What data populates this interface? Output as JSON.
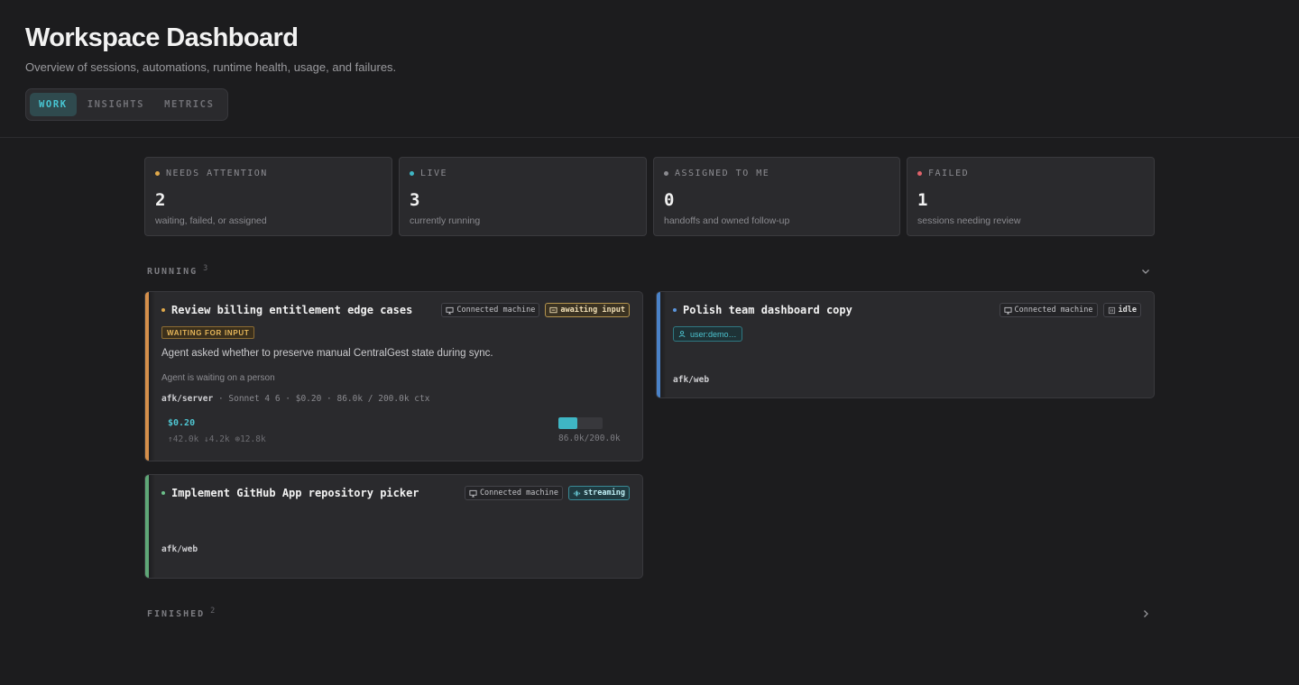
{
  "page": {
    "title": "Workspace Dashboard",
    "subtitle": "Overview of sessions, automations, runtime health, usage, and failures."
  },
  "tabs": [
    {
      "label": "WORK",
      "active": true
    },
    {
      "label": "INSIGHTS",
      "active": false
    },
    {
      "label": "METRICS",
      "active": false
    }
  ],
  "stats": [
    {
      "label": "NEEDS ATTENTION",
      "value": "2",
      "description": "waiting, failed, or assigned",
      "color": "#e0a84a"
    },
    {
      "label": "LIVE",
      "value": "3",
      "description": "currently running",
      "color": "#3fb6c4"
    },
    {
      "label": "ASSIGNED TO ME",
      "value": "0",
      "description": "handoffs and owned follow-up",
      "color": "#8a8a8f"
    },
    {
      "label": "FAILED",
      "value": "1",
      "description": "sessions needing review",
      "color": "#e0626a"
    }
  ],
  "running": {
    "title": "RUNNING",
    "count": "3",
    "cards": {
      "billing": {
        "title": "Review billing entitlement edge cases",
        "machine": "Connected machine",
        "status": "awaiting input",
        "chip": "WAITING FOR INPUT",
        "message": "Agent asked whether to preserve manual CentralGest state during sync.",
        "status_line": "Agent is waiting on a person",
        "repo": "afk/server",
        "meta": "· Sonnet 4 6 · $0.20 · 86.0k / 200.0k ctx",
        "cost": "$0.20",
        "tokens": "↑42.0k ↓4.2k ⊕12.8k",
        "context_fraction": 0.43,
        "context_text": "86.0k/200.0k",
        "accent": "#d58f4a"
      },
      "polish": {
        "title": "Polish team dashboard copy",
        "machine": "Connected machine",
        "status": "idle",
        "user": "user:demo…",
        "repo": "afk/web",
        "accent": "#4a82c8"
      },
      "github": {
        "title": "Implement GitHub App repository picker",
        "machine": "Connected machine",
        "status": "streaming",
        "repo": "afk/web",
        "accent": "#5fa777"
      }
    }
  },
  "finished": {
    "title": "FINISHED",
    "count": "2"
  }
}
